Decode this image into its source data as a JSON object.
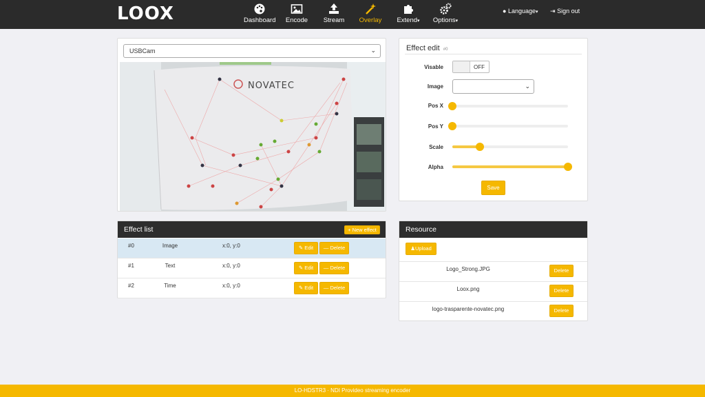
{
  "brand": {
    "logo": "LOOX"
  },
  "nav": {
    "items": [
      {
        "label": "Dashboard",
        "icon": "palette-icon"
      },
      {
        "label": "Encode",
        "icon": "image-icon"
      },
      {
        "label": "Stream",
        "icon": "upload-icon"
      },
      {
        "label": "Overlay",
        "icon": "magic-wand-icon",
        "active": true
      },
      {
        "label": "Extend",
        "icon": "puzzle-icon",
        "caret": "▾"
      },
      {
        "label": "Options",
        "icon": "gears-icon",
        "caret": "▾"
      }
    ],
    "language": "Language",
    "signout": "Sign out"
  },
  "camera": {
    "source": "USBCam",
    "preview_text": "NOVATEC"
  },
  "effect_edit": {
    "title": "Effect edit",
    "index": "#0",
    "visable_label": "Visable",
    "visable_state": "OFF",
    "image_label": "Image",
    "image_value": "",
    "posx_label": "Pos X",
    "posx_value": 0,
    "posy_label": "Pos Y",
    "posy_value": 0,
    "scale_label": "Scale",
    "scale_value": 0.24,
    "alpha_label": "Alpha",
    "alpha_value": 1.0,
    "save_label": "Save"
  },
  "effect_list": {
    "title": "Effect list",
    "new_label": "+ New effect",
    "edit_label": "Edit",
    "delete_label": "Delete",
    "rows": [
      {
        "id": "#0",
        "type": "Image",
        "pos": "x:0, y:0",
        "selected": true
      },
      {
        "id": "#1",
        "type": "Text",
        "pos": "x:0, y:0",
        "selected": false
      },
      {
        "id": "#2",
        "type": "Time",
        "pos": "x:0, y:0",
        "selected": false
      }
    ]
  },
  "resource": {
    "title": "Resource",
    "upload_label": "Upload",
    "delete_label": "Delete",
    "files": [
      "Logo_Strong.JPG",
      "Loox.png",
      "logo-trasparente-novatec.png"
    ]
  },
  "footer": {
    "text": "LO-HDSTR3 · NDI Provideo streaming encoder"
  },
  "colors": {
    "accent": "#f5b800",
    "topbar": "#2b2b2b",
    "selected_row": "#d8e8f3"
  }
}
